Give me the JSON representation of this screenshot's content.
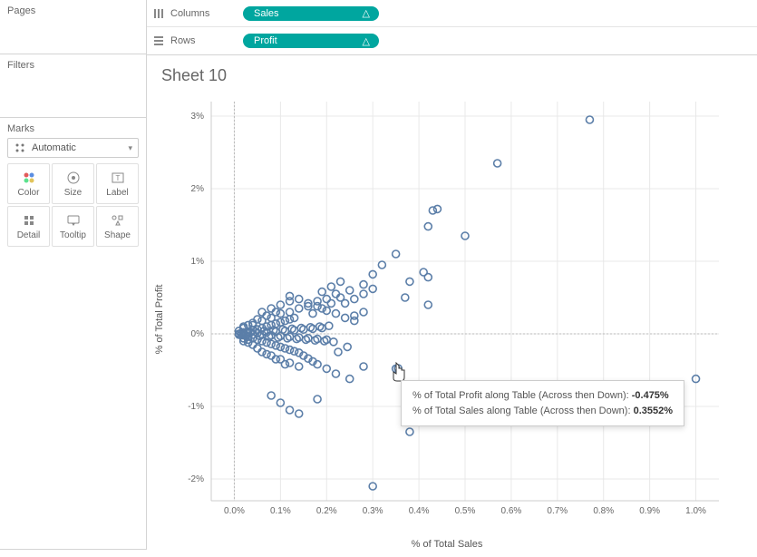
{
  "panels": {
    "pages": "Pages",
    "filters": "Filters",
    "marks": "Marks"
  },
  "marks": {
    "dropdown": "Automatic",
    "cells": [
      {
        "name": "Color"
      },
      {
        "name": "Size"
      },
      {
        "name": "Label"
      },
      {
        "name": "Detail"
      },
      {
        "name": "Tooltip"
      },
      {
        "name": "Shape"
      }
    ]
  },
  "shelves": {
    "columns": {
      "label": "Columns",
      "pill": "Sales"
    },
    "rows": {
      "label": "Rows",
      "pill": "Profit"
    }
  },
  "sheet": {
    "title": "Sheet 10",
    "xlabel": "% of Total Sales",
    "ylabel": "% of Total Profit"
  },
  "tooltip": {
    "line1_label": "% of Total Profit along Table (Across then Down):",
    "line1_value": "-0.475%",
    "line2_label": "% of Total Sales along Table (Across then Down):",
    "line2_value": "0.3552%"
  },
  "chart_data": {
    "type": "scatter",
    "xlabel": "% of Total Sales",
    "ylabel": "% of Total Profit",
    "xlim": [
      -0.05,
      1.05
    ],
    "ylim": [
      -2.3,
      3.2
    ],
    "x_ticks": [
      0.0,
      0.1,
      0.2,
      0.3,
      0.4,
      0.5,
      0.6,
      0.7,
      0.8,
      0.9,
      1.0
    ],
    "y_ticks": [
      -2,
      -1,
      0,
      1,
      2,
      3
    ],
    "x_tick_labels": [
      "0.0%",
      "0.1%",
      "0.2%",
      "0.3%",
      "0.4%",
      "0.5%",
      "0.6%",
      "0.7%",
      "0.8%",
      "0.9%",
      "1.0%"
    ],
    "y_tick_labels": [
      "-2%",
      "-1%",
      "0%",
      "1%",
      "2%",
      "3%"
    ],
    "zero_lines": {
      "x": 0.0,
      "y": 0.0
    },
    "point_color": "#5b7ea8",
    "series": [
      {
        "name": "points",
        "values": [
          [
            0.77,
            2.95
          ],
          [
            0.57,
            2.35
          ],
          [
            0.44,
            1.72
          ],
          [
            0.43,
            1.7
          ],
          [
            0.42,
            1.48
          ],
          [
            0.5,
            1.35
          ],
          [
            0.35,
            1.1
          ],
          [
            0.32,
            0.95
          ],
          [
            0.41,
            0.85
          ],
          [
            0.3,
            0.82
          ],
          [
            0.42,
            0.78
          ],
          [
            0.38,
            0.72
          ],
          [
            0.28,
            0.68
          ],
          [
            0.25,
            0.6
          ],
          [
            0.22,
            0.55
          ],
          [
            0.37,
            0.5
          ],
          [
            0.2,
            0.48
          ],
          [
            0.18,
            0.45
          ],
          [
            0.42,
            0.4
          ],
          [
            0.16,
            0.38
          ],
          [
            0.14,
            0.35
          ],
          [
            0.12,
            0.3
          ],
          [
            0.28,
            0.3
          ],
          [
            0.1,
            0.28
          ],
          [
            0.26,
            0.25
          ],
          [
            0.08,
            0.22
          ],
          [
            0.06,
            0.18
          ],
          [
            0.04,
            0.12
          ],
          [
            0.02,
            0.08
          ],
          [
            0.01,
            0.04
          ],
          [
            0.12,
            0.52
          ],
          [
            0.14,
            0.48
          ],
          [
            0.16,
            0.42
          ],
          [
            0.18,
            0.38
          ],
          [
            0.2,
            0.32
          ],
          [
            0.22,
            0.28
          ],
          [
            0.24,
            0.22
          ],
          [
            0.26,
            0.18
          ],
          [
            0.02,
            0.02
          ],
          [
            0.03,
            0.03
          ],
          [
            0.04,
            0.05
          ],
          [
            0.05,
            0.06
          ],
          [
            0.06,
            0.08
          ],
          [
            0.07,
            0.1
          ],
          [
            0.08,
            0.12
          ],
          [
            0.09,
            0.14
          ],
          [
            0.1,
            0.16
          ],
          [
            0.11,
            0.18
          ],
          [
            0.12,
            0.2
          ],
          [
            0.13,
            0.22
          ],
          [
            0.02,
            -0.02
          ],
          [
            0.03,
            -0.04
          ],
          [
            0.04,
            -0.06
          ],
          [
            0.05,
            -0.08
          ],
          [
            0.06,
            -0.1
          ],
          [
            0.07,
            -0.12
          ],
          [
            0.08,
            -0.14
          ],
          [
            0.09,
            -0.16
          ],
          [
            0.1,
            -0.18
          ],
          [
            0.11,
            -0.2
          ],
          [
            0.12,
            -0.22
          ],
          [
            0.13,
            -0.24
          ],
          [
            0.14,
            -0.26
          ],
          [
            0.15,
            -0.3
          ],
          [
            0.16,
            -0.34
          ],
          [
            0.17,
            -0.38
          ],
          [
            0.18,
            -0.42
          ],
          [
            0.2,
            -0.48
          ],
          [
            0.22,
            -0.55
          ],
          [
            0.25,
            -0.62
          ],
          [
            0.35,
            -0.48
          ],
          [
            0.28,
            -0.45
          ],
          [
            0.08,
            -0.85
          ],
          [
            0.1,
            -0.95
          ],
          [
            0.18,
            -0.9
          ],
          [
            0.14,
            -1.1
          ],
          [
            0.12,
            -1.05
          ],
          [
            0.38,
            -1.35
          ],
          [
            0.3,
            -2.1
          ],
          [
            0.355,
            -0.475
          ],
          [
            1.0,
            -0.62
          ],
          [
            0.05,
            0.01
          ],
          [
            0.06,
            -0.01
          ],
          [
            0.07,
            0.02
          ],
          [
            0.08,
            -0.02
          ],
          [
            0.09,
            0.03
          ],
          [
            0.1,
            -0.03
          ],
          [
            0.11,
            0.04
          ],
          [
            0.12,
            -0.04
          ],
          [
            0.13,
            0.05
          ],
          [
            0.14,
            -0.05
          ],
          [
            0.15,
            0.06
          ],
          [
            0.16,
            -0.06
          ],
          [
            0.17,
            0.07
          ],
          [
            0.18,
            -0.07
          ],
          [
            0.19,
            0.08
          ],
          [
            0.2,
            -0.08
          ],
          [
            0.02,
            0.0
          ],
          [
            0.03,
            0.01
          ],
          [
            0.04,
            -0.01
          ],
          [
            0.025,
            -0.02
          ],
          [
            0.035,
            0.02
          ],
          [
            0.045,
            0.03
          ],
          [
            0.055,
            -0.03
          ],
          [
            0.065,
            0.04
          ],
          [
            0.075,
            -0.04
          ],
          [
            0.085,
            0.05
          ],
          [
            0.095,
            -0.05
          ],
          [
            0.105,
            0.06
          ],
          [
            0.115,
            -0.06
          ],
          [
            0.125,
            0.07
          ],
          [
            0.135,
            -0.07
          ],
          [
            0.145,
            0.08
          ],
          [
            0.155,
            -0.08
          ],
          [
            0.165,
            0.09
          ],
          [
            0.175,
            -0.09
          ],
          [
            0.185,
            0.1
          ],
          [
            0.195,
            -0.1
          ],
          [
            0.205,
            0.11
          ],
          [
            0.215,
            -0.11
          ],
          [
            0.06,
            0.3
          ],
          [
            0.08,
            0.35
          ],
          [
            0.1,
            0.4
          ],
          [
            0.12,
            0.45
          ],
          [
            0.02,
            0.1
          ],
          [
            0.03,
            0.12
          ],
          [
            0.04,
            0.15
          ],
          [
            0.02,
            -0.1
          ],
          [
            0.03,
            -0.12
          ],
          [
            0.04,
            -0.15
          ],
          [
            0.24,
            0.42
          ],
          [
            0.26,
            0.48
          ],
          [
            0.28,
            0.55
          ],
          [
            0.3,
            0.62
          ],
          [
            0.05,
            0.2
          ],
          [
            0.07,
            0.25
          ],
          [
            0.09,
            0.3
          ],
          [
            0.01,
            0.0
          ],
          [
            0.015,
            0.01
          ],
          [
            0.01,
            -0.01
          ],
          [
            0.015,
            -0.02
          ],
          [
            0.06,
            -0.25
          ],
          [
            0.08,
            -0.3
          ],
          [
            0.1,
            -0.35
          ],
          [
            0.12,
            -0.4
          ],
          [
            0.14,
            -0.45
          ],
          [
            0.225,
            -0.25
          ],
          [
            0.245,
            -0.18
          ],
          [
            0.19,
            0.58
          ],
          [
            0.21,
            0.65
          ],
          [
            0.23,
            0.72
          ],
          [
            0.17,
            0.28
          ],
          [
            0.19,
            0.35
          ],
          [
            0.21,
            0.42
          ],
          [
            0.23,
            0.5
          ],
          [
            0.05,
            -0.2
          ],
          [
            0.07,
            -0.28
          ],
          [
            0.09,
            -0.35
          ],
          [
            0.11,
            -0.42
          ],
          [
            0.03,
            -0.08
          ],
          [
            0.02,
            -0.06
          ]
        ]
      }
    ],
    "hover_point": {
      "x": 0.355,
      "y": -0.475
    }
  }
}
